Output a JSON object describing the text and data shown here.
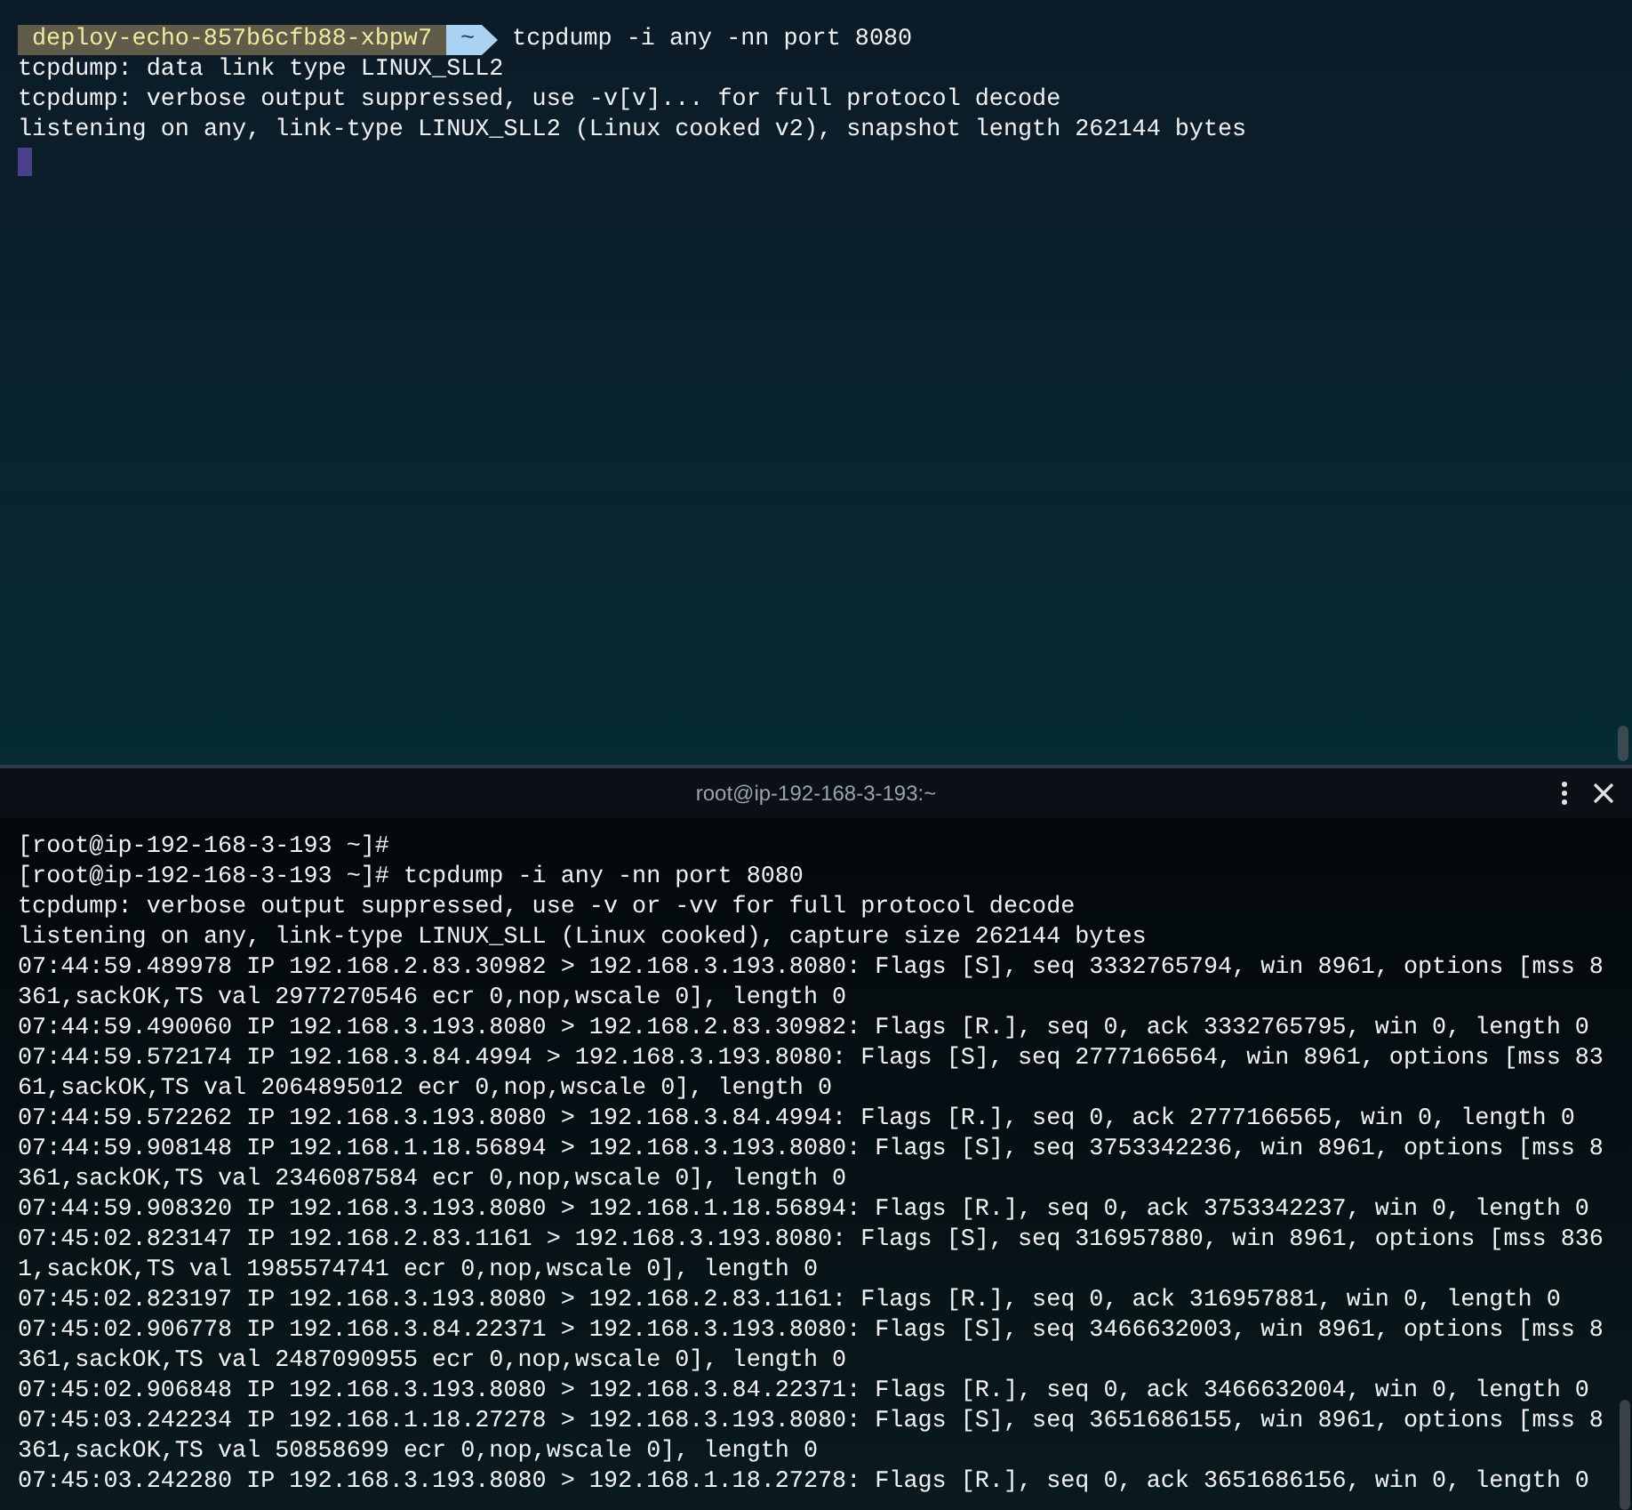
{
  "top_pane": {
    "prompt": {
      "host": "deploy-echo-857b6cfb88-xbpw7",
      "dir": "~",
      "command": "tcpdump -i any -nn port 8080"
    },
    "lines": [
      "tcpdump: data link type LINUX_SLL2",
      "tcpdump: verbose output suppressed, use -v[v]... for full protocol decode",
      "listening on any, link-type LINUX_SLL2 (Linux cooked v2), snapshot length 262144 bytes"
    ]
  },
  "bottom_pane": {
    "title": "root@ip-192-168-3-193:~",
    "lines": [
      "[root@ip-192-168-3-193 ~]#",
      "[root@ip-192-168-3-193 ~]# tcpdump -i any -nn port 8080",
      "tcpdump: verbose output suppressed, use -v or -vv for full protocol decode",
      "listening on any, link-type LINUX_SLL (Linux cooked), capture size 262144 bytes",
      "07:44:59.489978 IP 192.168.2.83.30982 > 192.168.3.193.8080: Flags [S], seq 3332765794, win 8961, options [mss 8",
      "361,sackOK,TS val 2977270546 ecr 0,nop,wscale 0], length 0",
      "07:44:59.490060 IP 192.168.3.193.8080 > 192.168.2.83.30982: Flags [R.], seq 0, ack 3332765795, win 0, length 0",
      "07:44:59.572174 IP 192.168.3.84.4994 > 192.168.3.193.8080: Flags [S], seq 2777166564, win 8961, options [mss 83",
      "61,sackOK,TS val 2064895012 ecr 0,nop,wscale 0], length 0",
      "07:44:59.572262 IP 192.168.3.193.8080 > 192.168.3.84.4994: Flags [R.], seq 0, ack 2777166565, win 0, length 0",
      "07:44:59.908148 IP 192.168.1.18.56894 > 192.168.3.193.8080: Flags [S], seq 3753342236, win 8961, options [mss 8",
      "361,sackOK,TS val 2346087584 ecr 0,nop,wscale 0], length 0",
      "07:44:59.908320 IP 192.168.3.193.8080 > 192.168.1.18.56894: Flags [R.], seq 0, ack 3753342237, win 0, length 0",
      "07:45:02.823147 IP 192.168.2.83.1161 > 192.168.3.193.8080: Flags [S], seq 316957880, win 8961, options [mss 836",
      "1,sackOK,TS val 1985574741 ecr 0,nop,wscale 0], length 0",
      "07:45:02.823197 IP 192.168.3.193.8080 > 192.168.2.83.1161: Flags [R.], seq 0, ack 316957881, win 0, length 0",
      "07:45:02.906778 IP 192.168.3.84.22371 > 192.168.3.193.8080: Flags [S], seq 3466632003, win 8961, options [mss 8",
      "361,sackOK,TS val 2487090955 ecr 0,nop,wscale 0], length 0",
      "07:45:02.906848 IP 192.168.3.193.8080 > 192.168.3.84.22371: Flags [R.], seq 0, ack 3466632004, win 0, length 0",
      "07:45:03.242234 IP 192.168.1.18.27278 > 192.168.3.193.8080: Flags [S], seq 3651686155, win 8961, options [mss 8",
      "361,sackOK,TS val 50858699 ecr 0,nop,wscale 0], length 0",
      "07:45:03.242280 IP 192.168.3.193.8080 > 192.168.1.18.27278: Flags [R.], seq 0, ack 3651686156, win 0, length 0"
    ]
  }
}
